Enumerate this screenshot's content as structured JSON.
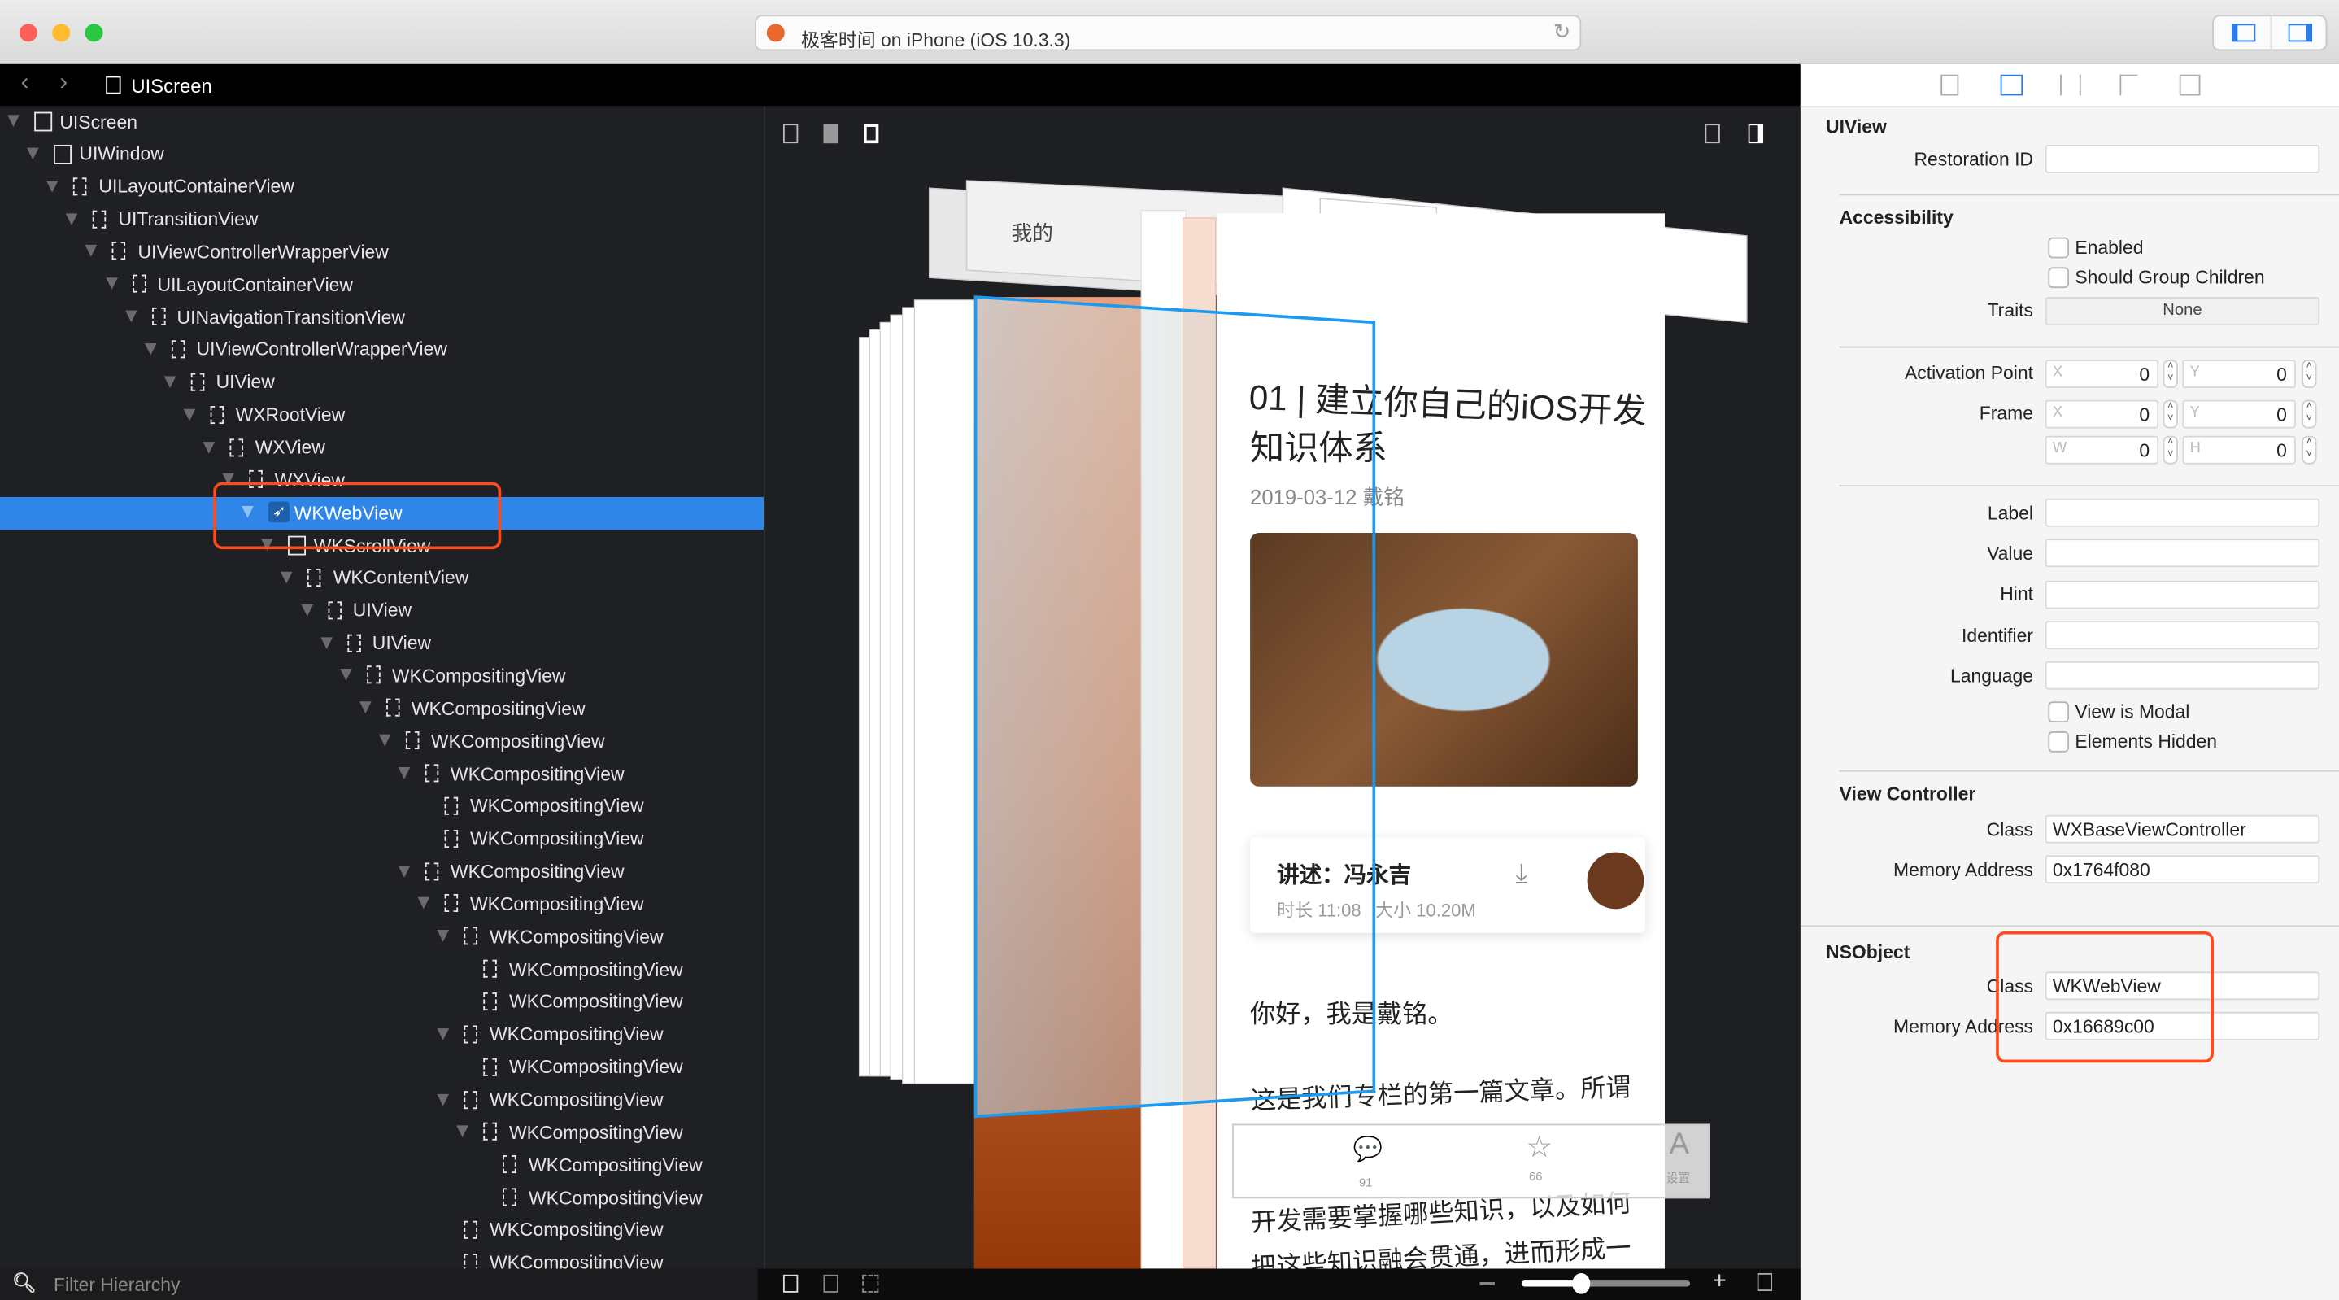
{
  "window": {
    "title": "极客时间 on iPhone (iOS 10.3.3)",
    "traffic_lights": [
      "#fe5f57",
      "#febc2e",
      "#28c840"
    ]
  },
  "navbar": {
    "breadcrumb": "UIScreen"
  },
  "tree": {
    "selected": "WKWebView",
    "rows": [
      {
        "label": "UIScreen",
        "depth": 0,
        "expanded": true,
        "icon": "screen"
      },
      {
        "label": "UIWindow",
        "depth": 1,
        "expanded": true,
        "icon": "window"
      },
      {
        "label": "UILayoutContainerView",
        "depth": 2,
        "expanded": true,
        "icon": "view"
      },
      {
        "label": "UITransitionView",
        "depth": 3,
        "expanded": true,
        "icon": "view"
      },
      {
        "label": "UIViewControllerWrapperView",
        "depth": 4,
        "expanded": true,
        "icon": "view"
      },
      {
        "label": "UILayoutContainerView",
        "depth": 5,
        "expanded": true,
        "icon": "view"
      },
      {
        "label": "UINavigationTransitionView",
        "depth": 6,
        "expanded": true,
        "icon": "view"
      },
      {
        "label": "UIViewControllerWrapperView",
        "depth": 7,
        "expanded": true,
        "icon": "view"
      },
      {
        "label": "UIView",
        "depth": 8,
        "expanded": true,
        "icon": "view"
      },
      {
        "label": "WXRootView",
        "depth": 9,
        "expanded": true,
        "icon": "view"
      },
      {
        "label": "WXView",
        "depth": 10,
        "expanded": true,
        "icon": "view"
      },
      {
        "label": "WXView",
        "depth": 11,
        "expanded": true,
        "icon": "view"
      },
      {
        "label": "WKWebView",
        "depth": 12,
        "expanded": true,
        "icon": "webview",
        "selected": true
      },
      {
        "label": "WKScrollView",
        "depth": 13,
        "expanded": true,
        "icon": "scrollview"
      },
      {
        "label": "WKContentView",
        "depth": 14,
        "expanded": true,
        "icon": "view"
      },
      {
        "label": "UIView",
        "depth": 15,
        "expanded": true,
        "icon": "view"
      },
      {
        "label": "UIView",
        "depth": 16,
        "expanded": true,
        "icon": "view"
      },
      {
        "label": "WKCompositingView",
        "depth": 17,
        "expanded": true,
        "icon": "view"
      },
      {
        "label": "WKCompositingView",
        "depth": 18,
        "expanded": true,
        "icon": "view"
      },
      {
        "label": "WKCompositingView",
        "depth": 19,
        "expanded": true,
        "icon": "view"
      },
      {
        "label": "WKCompositingView",
        "depth": 20,
        "expanded": true,
        "icon": "view"
      },
      {
        "label": "WKCompositingView",
        "depth": 21,
        "expanded": false,
        "icon": "view"
      },
      {
        "label": "WKCompositingView",
        "depth": 21,
        "expanded": false,
        "icon": "view"
      },
      {
        "label": "WKCompositingView",
        "depth": 20,
        "expanded": true,
        "icon": "view"
      },
      {
        "label": "WKCompositingView",
        "depth": 21,
        "expanded": true,
        "icon": "view"
      },
      {
        "label": "WKCompositingView",
        "depth": 22,
        "expanded": true,
        "icon": "view"
      },
      {
        "label": "WKCompositingView",
        "depth": 23,
        "expanded": false,
        "icon": "view"
      },
      {
        "label": "WKCompositingView",
        "depth": 23,
        "expanded": false,
        "icon": "view"
      },
      {
        "label": "WKCompositingView",
        "depth": 22,
        "expanded": true,
        "icon": "view"
      },
      {
        "label": "WKCompositingView",
        "depth": 23,
        "expanded": false,
        "icon": "view"
      },
      {
        "label": "WKCompositingView",
        "depth": 22,
        "expanded": true,
        "icon": "view"
      },
      {
        "label": "WKCompositingView",
        "depth": 23,
        "expanded": true,
        "icon": "view"
      },
      {
        "label": "WKCompositingView",
        "depth": 24,
        "expanded": false,
        "icon": "view"
      },
      {
        "label": "WKCompositingView",
        "depth": 24,
        "expanded": false,
        "icon": "view"
      },
      {
        "label": "WKCompositingView",
        "depth": 22,
        "expanded": false,
        "icon": "view"
      },
      {
        "label": "WKCompositingView",
        "depth": 22,
        "expanded": false,
        "icon": "view"
      }
    ]
  },
  "filter": {
    "placeholder": "Filter Hierarchy"
  },
  "zoom_slider": {
    "value": 0.35
  },
  "preview": {
    "article_title_1": "01 | 建立你自己的iOS开发",
    "article_title_2": "知识体系",
    "date": "2019-03-12",
    "author": "戴铭",
    "narrator": "讲述：冯永吉",
    "duration": "时长 11:08",
    "size": "大小 10.20M",
    "greeting": "你好，我是戴铭。",
    "body_lines": [
      "这是我们专栏的第一篇文章。所谓",
      "开发需要掌握哪些知识，以及如何",
      "把这些知识融会贯通，进而形成一"
    ],
    "toolbar": {
      "comments": "91",
      "likes": "66",
      "settings": "设置"
    },
    "back_nav_partial": "我的",
    "selection_color": "#1a9af0"
  },
  "inspector": {
    "uiview": {
      "header": "UIView",
      "restoration_id_label": "Restoration ID",
      "restoration_id": ""
    },
    "accessibility": {
      "header": "Accessibility",
      "enabled_label": "Enabled",
      "enabled": false,
      "group_label": "Should Group Children",
      "group": false,
      "traits_label": "Traits",
      "traits": "None",
      "activation_label": "Activation Point",
      "activation": {
        "x": "0",
        "y": "0"
      },
      "frame_label": "Frame",
      "frame": {
        "x": "0",
        "y": "0",
        "w": "0",
        "h": "0"
      },
      "ph": {
        "x": "X",
        "y": "Y",
        "w": "W",
        "h": "H"
      },
      "label_label": "Label",
      "label": "",
      "value_label": "Value",
      "value": "",
      "hint_label": "Hint",
      "hint": "",
      "identifier_label": "Identifier",
      "identifier": "",
      "language_label": "Language",
      "language": "",
      "modal_label": "View is Modal",
      "modal": false,
      "hidden_label": "Elements Hidden",
      "hidden": false
    },
    "view_controller": {
      "header": "View Controller",
      "class_label": "Class",
      "class": "WXBaseViewController",
      "address_label": "Memory Address",
      "address": "0x1764f080"
    },
    "nsobject": {
      "header": "NSObject",
      "class_label": "Class",
      "class": "WKWebView",
      "address_label": "Memory Address",
      "address": "0x16689c00"
    }
  },
  "colors": {
    "accent": "#2f86e8",
    "highlight": "#ff4a1c"
  }
}
